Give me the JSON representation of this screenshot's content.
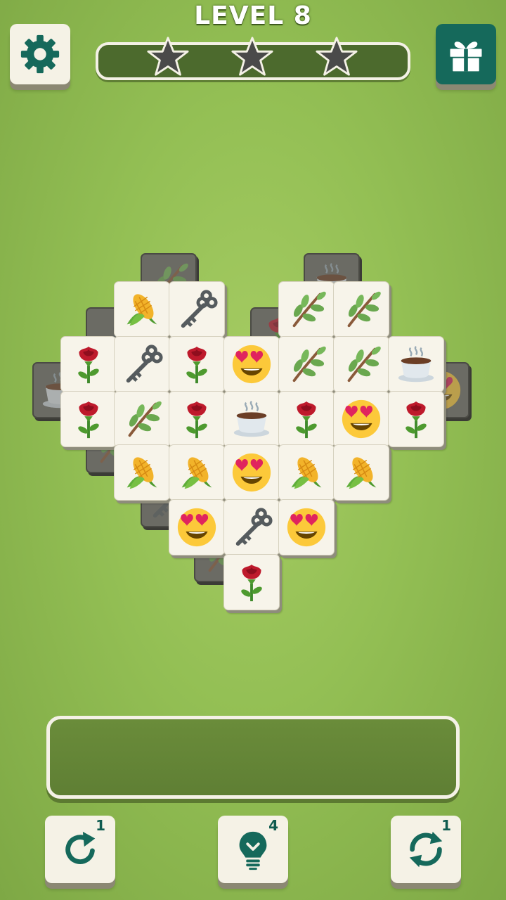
{
  "header": {
    "level_label": "LEVEL 8",
    "progress": 0,
    "stars": [
      {
        "name": "star-1",
        "filled": false
      },
      {
        "name": "star-2",
        "filled": false
      },
      {
        "name": "star-3",
        "filled": false
      }
    ]
  },
  "icons": {
    "settings": "gear-icon",
    "gift": "gift-icon",
    "undo": "undo-icon",
    "hint": "lightbulb-icon",
    "shuffle": "shuffle-icon"
  },
  "colors": {
    "background": "#93bf54",
    "accent_teal": "#15695b",
    "tile_face": "#f7f4ea",
    "tray": "#5f7f34"
  },
  "board": {
    "tiles": [
      {
        "symbol": "branch",
        "layer": "under"
      },
      {
        "symbol": "coffee",
        "layer": "under"
      },
      {
        "symbol": "key",
        "layer": "under"
      },
      {
        "symbol": "rose",
        "layer": "under"
      },
      {
        "symbol": "coffee",
        "layer": "under"
      },
      {
        "symbol": "heart-eyes",
        "layer": "under"
      },
      {
        "symbol": "branch",
        "layer": "under"
      },
      {
        "symbol": "key",
        "layer": "under"
      },
      {
        "symbol": "branch",
        "layer": "under"
      },
      {
        "symbol": "corn",
        "layer": "top"
      },
      {
        "symbol": "key",
        "layer": "top"
      },
      {
        "symbol": "branch",
        "layer": "top"
      },
      {
        "symbol": "branch",
        "layer": "top"
      },
      {
        "symbol": "rose",
        "layer": "top"
      },
      {
        "symbol": "key",
        "layer": "top"
      },
      {
        "symbol": "rose",
        "layer": "top"
      },
      {
        "symbol": "heart-eyes",
        "layer": "top"
      },
      {
        "symbol": "branch",
        "layer": "top"
      },
      {
        "symbol": "branch",
        "layer": "top"
      },
      {
        "symbol": "coffee",
        "layer": "top"
      },
      {
        "symbol": "rose",
        "layer": "top"
      },
      {
        "symbol": "branch",
        "layer": "top"
      },
      {
        "symbol": "rose",
        "layer": "top"
      },
      {
        "symbol": "coffee",
        "layer": "top"
      },
      {
        "symbol": "rose",
        "layer": "top"
      },
      {
        "symbol": "heart-eyes",
        "layer": "top"
      },
      {
        "symbol": "rose",
        "layer": "top"
      },
      {
        "symbol": "corn",
        "layer": "top"
      },
      {
        "symbol": "corn",
        "layer": "top"
      },
      {
        "symbol": "heart-eyes",
        "layer": "top"
      },
      {
        "symbol": "corn",
        "layer": "top"
      },
      {
        "symbol": "corn",
        "layer": "top"
      },
      {
        "symbol": "heart-eyes",
        "layer": "top"
      },
      {
        "symbol": "key",
        "layer": "top"
      },
      {
        "symbol": "heart-eyes",
        "layer": "top"
      },
      {
        "symbol": "rose",
        "layer": "top"
      }
    ]
  },
  "tray": {
    "slots_filled": 0
  },
  "tools": {
    "undo_count": "1",
    "hint_count": "4",
    "shuffle_count": "1"
  }
}
